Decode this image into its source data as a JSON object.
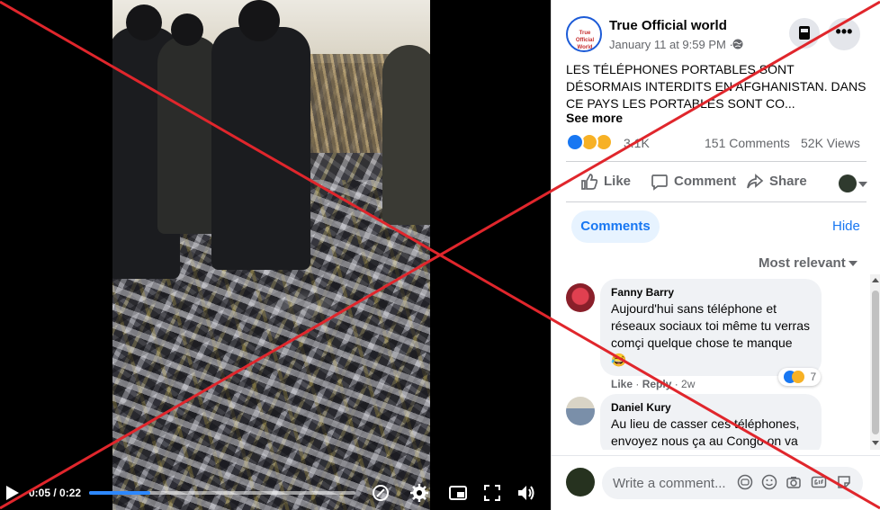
{
  "video": {
    "time_display": "0:05 / 0:22",
    "progress": 0.23
  },
  "post": {
    "page_name": "True Official world",
    "avatar_logo_text": "True Official World",
    "timestamp": "January 11 at 9:59 PM ·",
    "text": "LES TÉLÉPHONES PORTABLES SONT DÉSORMAIS INTERDITS EN AFGHANISTAN. DANS CE PAYS LES PORTABLES SONT CO...",
    "see_more": "See more",
    "reaction_count": "3.1K",
    "comments_count": "151 Comments",
    "views_count": "52K Views"
  },
  "actions": {
    "like": "Like",
    "comment": "Comment",
    "share": "Share"
  },
  "comments_section": {
    "tab_label": "Comments",
    "hide_label": "Hide",
    "sort_label": "Most relevant"
  },
  "comments": [
    {
      "author": "Fanny Barry",
      "text": "Aujourd'hui sans téléphone et réseaux sociaux toi même tu verras comçi quelque chose te manque 😂",
      "reaction_count": "7",
      "like_label": "Like",
      "reply_label": "Reply",
      "age": "2w"
    },
    {
      "author": "Daniel Kury",
      "text": "Au lieu de casser ces téléphones, envoyez nous ça au Congo on va"
    }
  ],
  "composer": {
    "placeholder": "Write a comment..."
  },
  "colors": {
    "accent": "#1877f2",
    "overlay_x": "#e0262c",
    "progress": "#2d88ff"
  },
  "icons": [
    "play-icon",
    "settings-gear-icon",
    "picture-in-picture-icon",
    "fullscreen-icon",
    "volume-icon",
    "globe-icon",
    "save-icon",
    "more-dots-icon",
    "like-thumb-icon",
    "comment-bubble-icon",
    "share-arrow-icon",
    "emoji-icon",
    "camera-icon",
    "gif-icon",
    "sticker-icon"
  ]
}
